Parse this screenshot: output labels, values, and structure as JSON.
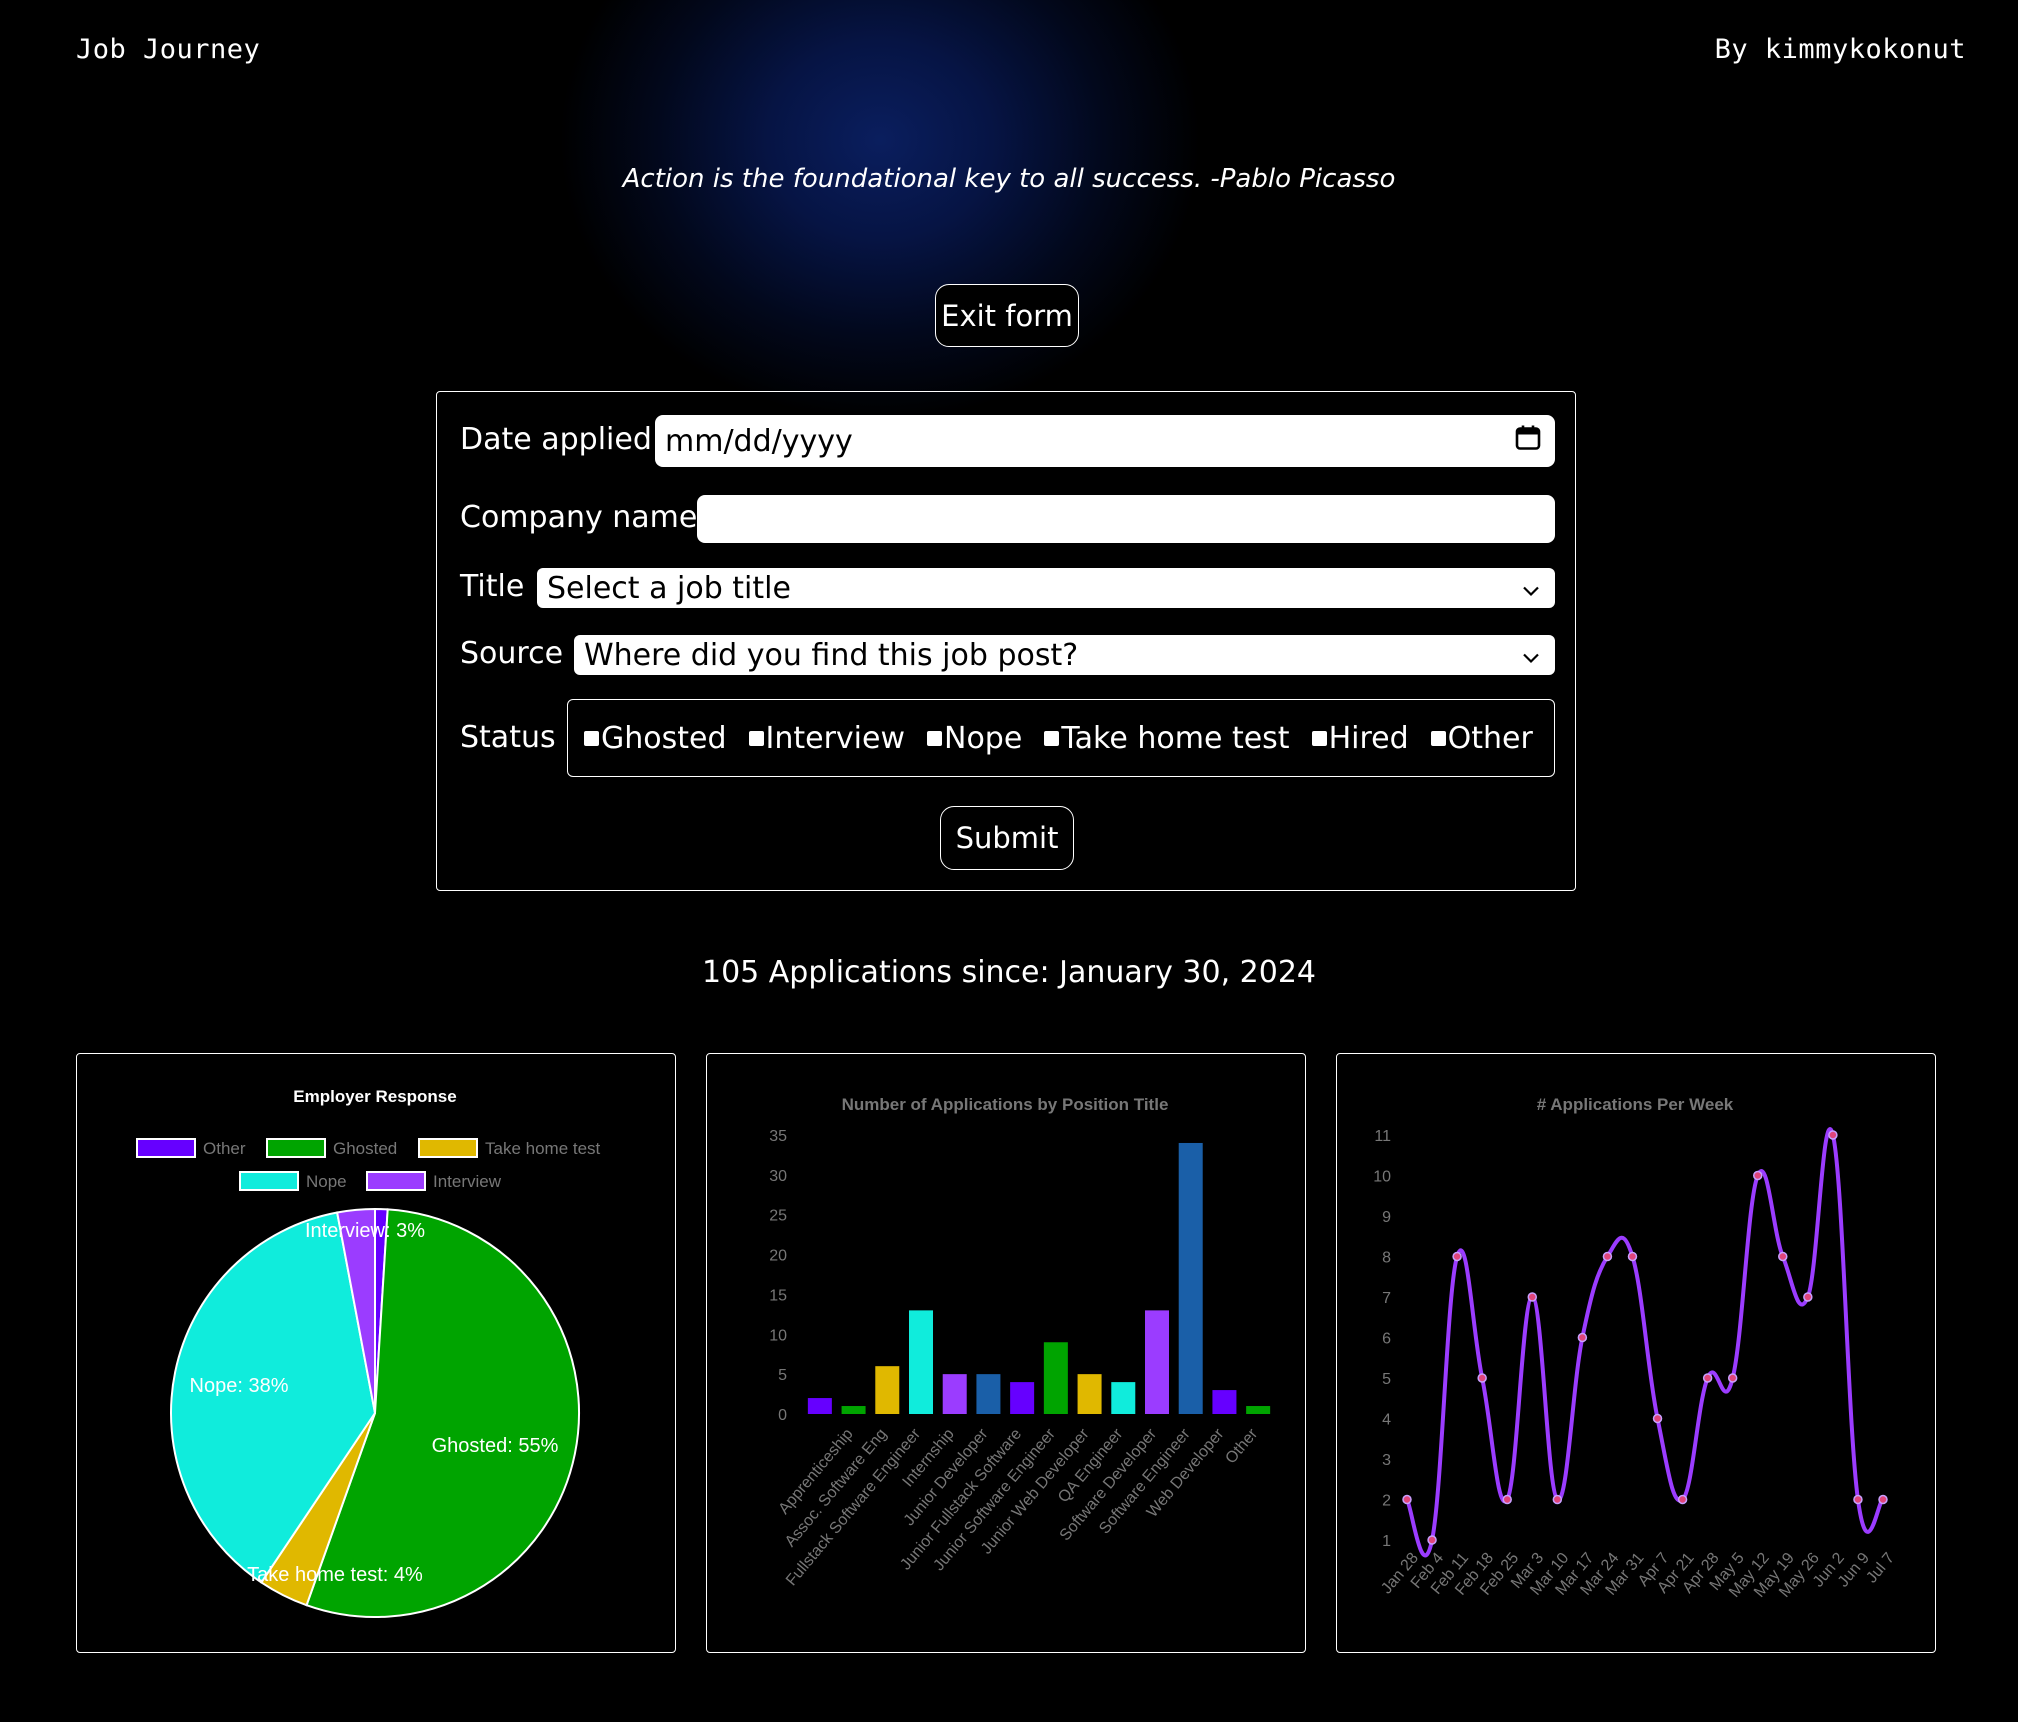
{
  "header": {
    "brand": "Job Journey",
    "author": "By kimmykokonut"
  },
  "quote": "Action is the foundational key to all success. -Pablo Picasso",
  "exit_label": "Exit form",
  "form": {
    "date_label": "Date applied",
    "date_placeholder": "mm/dd/yyyy",
    "date_icon": "calendar-icon",
    "company_label": "Company name",
    "company_value": "",
    "title_label": "Title",
    "title_selected": "Select a job title",
    "source_label": "Source",
    "source_selected": "Where did you find this job post?",
    "status_label": "Status",
    "status_options": [
      "Ghosted",
      "Interview",
      "Nope",
      "Take home test",
      "Hired",
      "Other"
    ],
    "submit_label": "Submit"
  },
  "summary": "105 Applications since: January 30, 2024",
  "chart_data": [
    {
      "type": "pie",
      "title": "Employer Response",
      "legend_position": "top",
      "legend": [
        "Other",
        "Ghosted",
        "Take home test",
        "Nope",
        "Interview"
      ],
      "slices": [
        {
          "name": "Other",
          "percent": 1,
          "color": "#6600ff",
          "label": ""
        },
        {
          "name": "Ghosted",
          "percent": 55,
          "color": "#00a400",
          "label": "Ghosted: 55%"
        },
        {
          "name": "Take home test",
          "percent": 4,
          "color": "#e0b800",
          "label": "Take home test: 4%"
        },
        {
          "name": "Nope",
          "percent": 38,
          "color": "#10ecdc",
          "label": "Nope: 38%"
        },
        {
          "name": "Interview",
          "percent": 3,
          "color": "#9b3cff",
          "label": "Interview: 3%"
        }
      ]
    },
    {
      "type": "bar",
      "title": "Number of Applications by Position Title",
      "ylim": [
        0,
        35
      ],
      "yticks": [
        0,
        5,
        10,
        15,
        20,
        25,
        30,
        35
      ],
      "grid": false,
      "legend": false,
      "categories": [
        "Apprenticeship",
        "Assoc. Software Eng",
        "Fullstack Software Engineer",
        "Internship",
        "Junior Developer",
        "Junior Fullstack Software",
        "Junior Software Engineer",
        "Junior Web Developer",
        "QA Engineer",
        "Software Developer",
        "Software Engineer",
        "Web Developer",
        "Other"
      ],
      "values": [
        2,
        1,
        6,
        13,
        5,
        5,
        4,
        9,
        5,
        4,
        13,
        34,
        3,
        1
      ],
      "colors": [
        "#6600ff",
        "#00a400",
        "#e0b800",
        "#10ecdc",
        "#9b3cff",
        "#1a5fa8",
        "#6600ff",
        "#00a400",
        "#e0b800",
        "#10ecdc",
        "#9b3cff",
        "#1a5fa8",
        "#6600ff",
        "#00a400"
      ]
    },
    {
      "type": "line",
      "title": "# Applications Per Week",
      "ylim": [
        1,
        11
      ],
      "yticks": [
        1,
        2,
        3,
        4,
        5,
        6,
        7,
        8,
        9,
        10,
        11
      ],
      "grid": false,
      "legend": false,
      "color": "#9b3cff",
      "point_color": "#e0457b",
      "x": [
        "Jan 28",
        "Feb 4",
        "Feb 11",
        "Feb 18",
        "Feb 25",
        "Mar 3",
        "Mar 10",
        "Mar 17",
        "Mar 24",
        "Mar 31",
        "Apr 7",
        "Apr 21",
        "Apr 28",
        "May 5",
        "May 12",
        "May 19",
        "May 26",
        "Jun 2",
        "Jun 9",
        "Jul 7"
      ],
      "values": [
        2,
        1,
        8,
        5,
        2,
        7,
        2,
        6,
        8,
        8,
        4,
        2,
        5,
        5,
        10,
        8,
        7,
        11,
        2,
        2
      ]
    }
  ]
}
